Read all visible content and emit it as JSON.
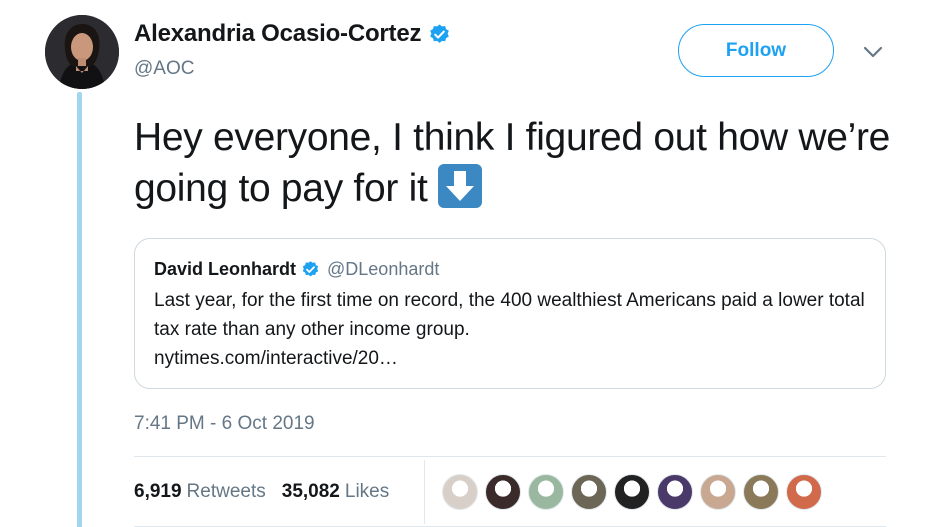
{
  "tweet": {
    "author_name": "Alexandria Ocasio-Cortez",
    "author_handle": "@AOC",
    "verified_icon": "verified-badge-icon",
    "follow_label": "Follow",
    "menu_icon": "chevron-down-icon",
    "text": "Hey everyone, I think I figured out how we’re going to pay for it",
    "emoji": "down-arrow-emoji-icon",
    "timestamp": "7:41 PM - 6 Oct 2019"
  },
  "quoted_tweet": {
    "author_name": "David Leonhardt",
    "author_handle": "@DLeonhardt",
    "text": "Last year, for the first time on record, the 400 wealthiest Americans paid a lower total tax rate than any other income group.",
    "link": "nytimes.com/interactive/20…"
  },
  "stats": {
    "retweets_count": "6,919",
    "retweets_label": "Retweets",
    "likes_count": "35,082",
    "likes_label": "Likes"
  },
  "likers": [
    {
      "name": "liker-avatar-1",
      "color": "#d8d0c8"
    },
    {
      "name": "liker-avatar-2",
      "color": "#3a2a2a"
    },
    {
      "name": "liker-avatar-3",
      "color": "#9ab8a0"
    },
    {
      "name": "liker-avatar-4",
      "color": "#6b6656"
    },
    {
      "name": "liker-avatar-5",
      "color": "#222222"
    },
    {
      "name": "liker-avatar-6",
      "color": "#4a3a6a"
    },
    {
      "name": "liker-avatar-7",
      "color": "#c8a890"
    },
    {
      "name": "liker-avatar-8",
      "color": "#8a7a5a"
    },
    {
      "name": "liker-avatar-9",
      "color": "#d06a4a"
    }
  ],
  "colors": {
    "accent": "#1da1f2",
    "thread_line": "#a3d5ef",
    "secondary_text": "#657786",
    "emoji_bg": "#3b88c3"
  }
}
